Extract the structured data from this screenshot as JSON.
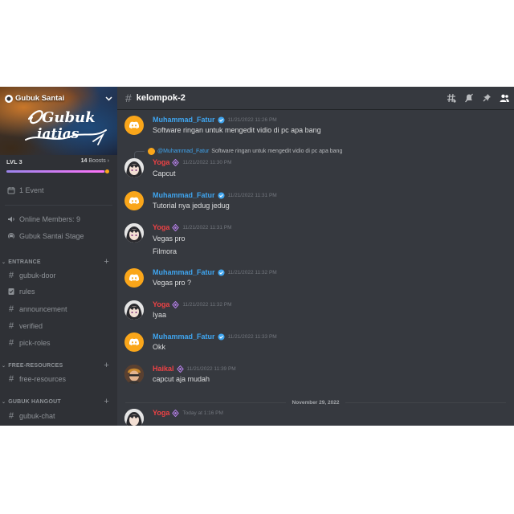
{
  "server": {
    "name": "Gubuk Santai",
    "banner_line1": "Gubuk",
    "banner_line2": "iatias",
    "level": "LVL 3",
    "boost_count": "14",
    "boost_label": "Boosts",
    "boost_progress": 0.97
  },
  "sidebar": {
    "event": "1 Event",
    "online": "Online Members: 9",
    "stage": "Gubuk Santai Stage",
    "categories": [
      {
        "name": "ENTRANCE",
        "channels": [
          "gubuk-door",
          "rules",
          "announcement",
          "verified",
          "pick-roles"
        ]
      },
      {
        "name": "FREE-RESOURCES",
        "channels": [
          "free-resources"
        ]
      },
      {
        "name": "GUBUK HANGOUT",
        "channels": [
          "gubuk-chat"
        ]
      }
    ]
  },
  "channel": {
    "name": "kelompok-2"
  },
  "messages": [
    {
      "author": "Muhammad_Fatur",
      "time": "11/21/2022 11:26 PM",
      "lines": [
        "Software ringan untuk mengedit vidio di pc apa bang"
      ]
    },
    {
      "reply_author": "@Muhammad_Fatur",
      "reply_text": "Software ringan untuk mengedit vidio di pc apa bang",
      "author": "Yoga",
      "time": "11/21/2022 11:30 PM",
      "lines": [
        "Capcut"
      ]
    },
    {
      "author": "Muhammad_Fatur",
      "time": "11/21/2022 11:31 PM",
      "lines": [
        "Tutorial nya jedug jedug"
      ]
    },
    {
      "author": "Yoga",
      "time": "11/21/2022 11:31 PM",
      "lines": [
        "Vegas pro",
        "Filmora"
      ]
    },
    {
      "author": "Muhammad_Fatur",
      "time": "11/21/2022 11:32 PM",
      "lines": [
        "Vegas pro ?"
      ]
    },
    {
      "author": "Yoga",
      "time": "11/21/2022 11:32 PM",
      "lines": [
        "Iyaa"
      ]
    },
    {
      "author": "Muhammad_Fatur",
      "time": "11/21/2022 11:33 PM",
      "lines": [
        "Okk"
      ]
    },
    {
      "author": "Haikal",
      "time": "11/21/2022 11:39 PM",
      "lines": [
        "capcut aja mudah"
      ]
    },
    {
      "author": "Yoga",
      "time": "Today at 1:16 PM",
      "lines": []
    }
  ],
  "date_divider": "November 29, 2022",
  "colors": {
    "sidebar_bg": "#2f3136",
    "main_bg": "#36393f",
    "link_blue": "#3fa5ef",
    "name_red": "#ed4245",
    "discord_orange": "#faa61a"
  },
  "icons": [
    "hashtag-icon",
    "threads-icon",
    "mute-icon",
    "pin-icon",
    "members-icon",
    "calendar-icon",
    "speaker-icon",
    "stage-icon",
    "verified-icon",
    "nitro-icon"
  ]
}
